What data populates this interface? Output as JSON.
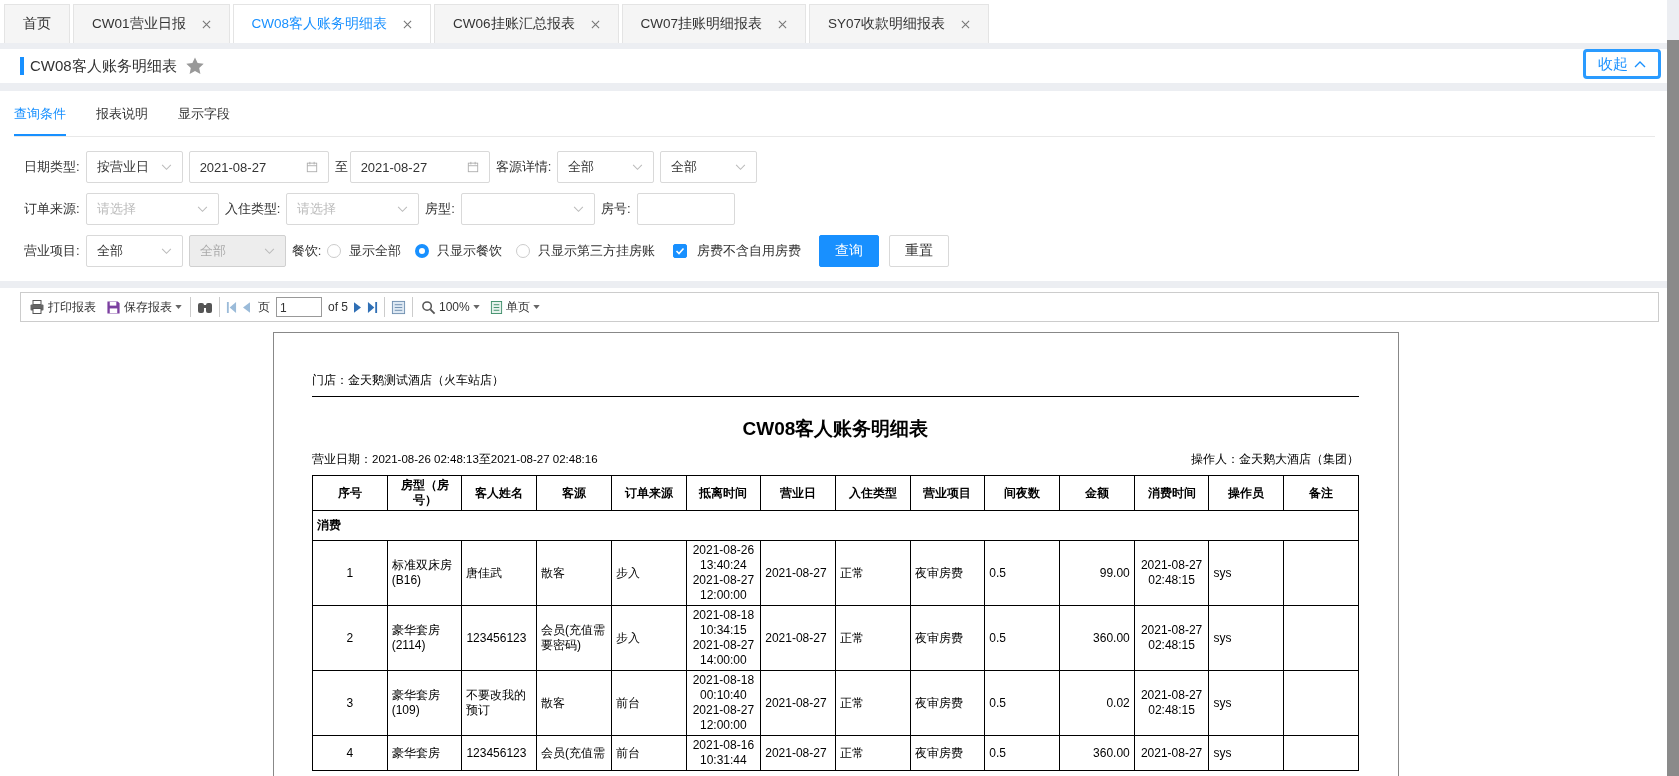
{
  "tabs": [
    {
      "label": "首页",
      "closable": false,
      "selected": false
    },
    {
      "label": "CW01营业日报",
      "closable": true,
      "selected": false
    },
    {
      "label": "CW08客人账务明细表",
      "closable": true,
      "selected": true
    },
    {
      "label": "CW06挂账汇总报表",
      "closable": true,
      "selected": false
    },
    {
      "label": "CW07挂账明细报表",
      "closable": true,
      "selected": false
    },
    {
      "label": "SY07收款明细报表",
      "closable": true,
      "selected": false
    }
  ],
  "page_title": "CW08客人账务明细表",
  "collapse_button": "收起",
  "sub_tabs": [
    {
      "label": "查询条件",
      "selected": true
    },
    {
      "label": "报表说明",
      "selected": false
    },
    {
      "label": "显示字段",
      "selected": false
    }
  ],
  "filter_rows": [
    {
      "fields": [
        {
          "kind": "select",
          "label": "日期类型:",
          "value": "按营业日",
          "disabled": false
        },
        {
          "kind": "date",
          "value": "2021-08-27"
        },
        {
          "kind": "text",
          "text": "至"
        },
        {
          "kind": "date",
          "value": "2021-08-27"
        },
        {
          "kind": "select",
          "label": "客源详情:",
          "value": "全部",
          "disabled": false
        },
        {
          "kind": "select",
          "value": "全部",
          "disabled": false
        }
      ]
    },
    {
      "fields": [
        {
          "kind": "select",
          "label": "订单来源:",
          "placeholder": "请选择",
          "disabled": false
        },
        {
          "kind": "select",
          "label": "入住类型:",
          "placeholder": "请选择",
          "disabled": false
        },
        {
          "kind": "select",
          "label": "房型:",
          "disabled": false
        },
        {
          "kind": "input",
          "label": "房号:"
        }
      ]
    },
    {
      "fields": [
        {
          "kind": "select",
          "label": "营业项目:",
          "value": "全部",
          "disabled": false
        },
        {
          "kind": "select",
          "value": "全部",
          "disabled": true
        },
        {
          "kind": "radio",
          "label": "餐饮:",
          "options": [
            {
              "label": "显示全部",
              "selected": false
            },
            {
              "label": "只显示餐饮",
              "selected": true
            },
            {
              "label": "只显示第三方挂房账",
              "selected": false
            }
          ]
        },
        {
          "kind": "checkbox",
          "label": "房费不含自用房费",
          "checked": true
        },
        {
          "kind": "button",
          "label": "查询",
          "primary": true
        },
        {
          "kind": "button",
          "label": "重置",
          "primary": false
        }
      ]
    }
  ],
  "toolbar": {
    "print": "打印报表",
    "save": "保存报表",
    "page_label": "页",
    "page_value": "1",
    "page_count": "of 5",
    "zoom": "100%",
    "view_mode": "单页"
  },
  "report": {
    "store": "门店：金天鹅测试酒店（火车站店）",
    "title": "CW08客人账务明细表",
    "date_range": "营业日期：2021-08-26 02:48:13至2021-08-27 02:48:16",
    "operator": "操作人：金天鹅大酒店（集团）",
    "columns": [
      "序号",
      "房型（房号）",
      "客人姓名",
      "客源",
      "订单来源",
      "抵离时间",
      "营业日",
      "入住类型",
      "营业项目",
      "间夜数",
      "金额",
      "消费时间",
      "操作员",
      "备注"
    ],
    "section": "消费",
    "rows": [
      {
        "index": "1",
        "room": "标准双床房(B16)",
        "guest": "唐佳武",
        "source": "散客",
        "order_source": "步入",
        "stay_time": "2021-08-26 13:40:24 2021-08-27 12:00:00",
        "business_date": "2021-08-27",
        "checkin_type": "正常",
        "item": "夜审房费",
        "room_nights": "0.5",
        "amount": "99.00",
        "consume_time": "2021-08-27 02:48:15",
        "operator": "sys"
      },
      {
        "index": "2",
        "room": "豪华套房(2114)",
        "guest": "123456123",
        "source": "会员(充值需要密码)",
        "order_source": "步入",
        "stay_time": "2021-08-18 10:34:15 2021-08-27 14:00:00",
        "business_date": "2021-08-27",
        "checkin_type": "正常",
        "item": "夜审房费",
        "room_nights": "0.5",
        "amount": "360.00",
        "consume_time": "2021-08-27 02:48:15",
        "operator": "sys"
      },
      {
        "index": "3",
        "room": "豪华套房(109)",
        "guest": "不要改我的预订",
        "source": "散客",
        "order_source": "前台",
        "stay_time": "2021-08-18 00:10:40 2021-08-27 12:00:00",
        "business_date": "2021-08-27",
        "checkin_type": "正常",
        "item": "夜审房费",
        "room_nights": "0.5",
        "amount": "0.02",
        "consume_time": "2021-08-27 02:48:15",
        "operator": "sys"
      },
      {
        "index": "4",
        "room": "豪华套房",
        "guest": "123456123",
        "source": "会员(充值需",
        "order_source": "前台",
        "stay_time": "2021-08-16 10:31:44",
        "business_date": "2021-08-27",
        "checkin_type": "正常",
        "item": "夜审房费",
        "room_nights": "0.5",
        "amount": "360.00",
        "consume_time": "2021-08-27",
        "operator": "sys"
      }
    ]
  }
}
